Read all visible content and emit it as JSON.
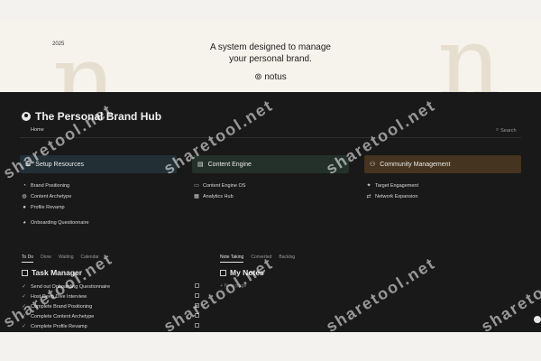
{
  "banner": {
    "year": "2025",
    "tagline_line1": "A system designed to manage",
    "tagline_line2": "your personal brand.",
    "logo": "⊚ notus"
  },
  "hub": {
    "title": "The Personal Brand Hub",
    "home_tab": "Home",
    "search_label": "Search"
  },
  "cards": [
    {
      "label": "Setup Resources",
      "color": "#223036",
      "items": [
        "Brand Positioning",
        "Content Archetype",
        "Profile Revamp"
      ],
      "extra": "Onboarding Questionnaire"
    },
    {
      "label": "Content Engine",
      "color": "#24312b",
      "items": [
        "Content Engine OS",
        "Analytics Hub"
      ]
    },
    {
      "label": "Community Management",
      "color": "#45341f",
      "items": [
        "Target Engagement",
        "Network Expansion"
      ]
    }
  ],
  "task_manager": {
    "tabs": [
      "To Do",
      "Done",
      "Waiting",
      "Calendar"
    ],
    "title": "Task Manager",
    "tasks": [
      "Send out Onboarding Questionnaire",
      "Host Deep Dive Interview",
      "Complete Brand Positioning",
      "Complete Content Archetype",
      "Complete Profile Revamp"
    ]
  },
  "notes": {
    "tabs": [
      "Note Taking",
      "Converted",
      "Backlog"
    ],
    "title": "My Notes",
    "new_page": "+ New page"
  },
  "watermark": "sharetool.net"
}
